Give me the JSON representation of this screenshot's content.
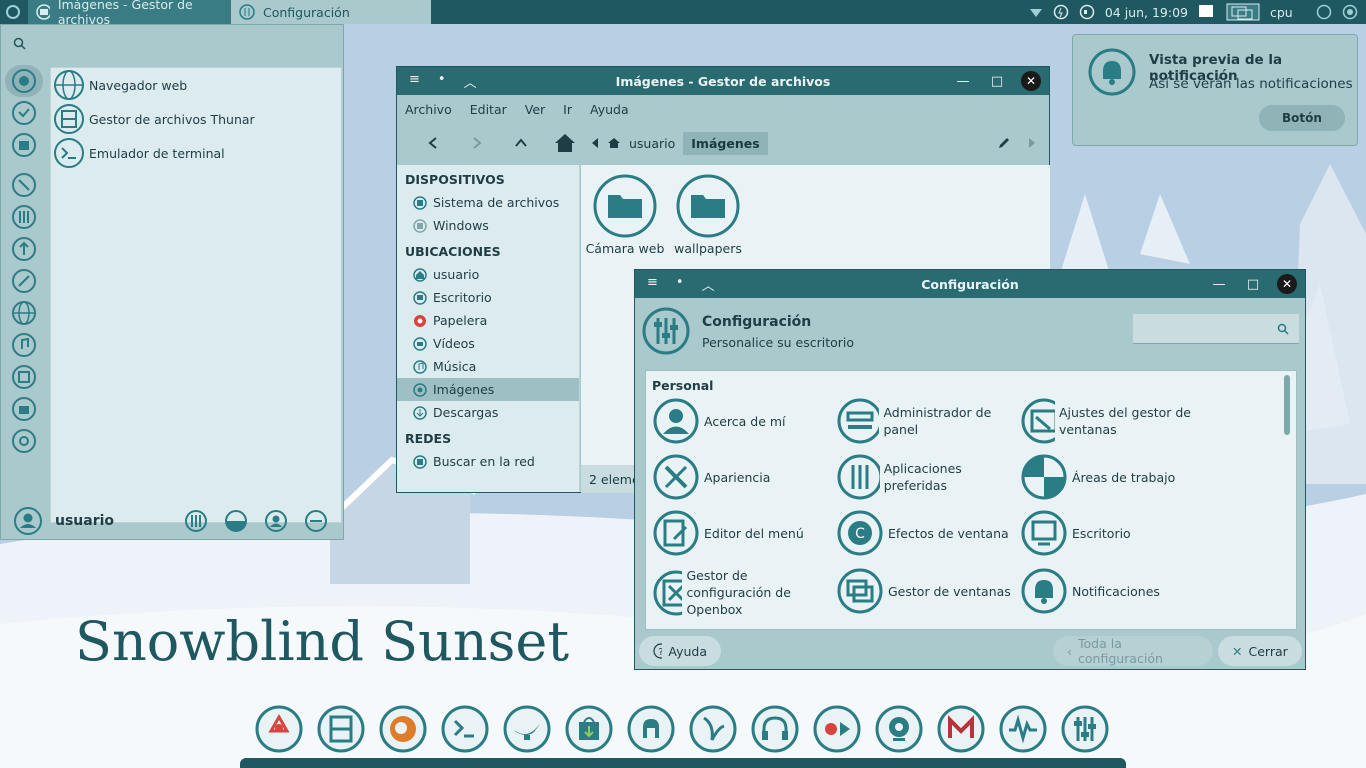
{
  "top_panel": {
    "tasks": [
      {
        "label": "Imágenes - Gestor de archivos",
        "icon": "folder-icon"
      },
      {
        "label": "Configuración",
        "icon": "settings-icon"
      }
    ],
    "datetime": "04 jun, 19:09",
    "cpu_label": "cpu"
  },
  "whisker": {
    "search_placeholder": "",
    "apps": [
      {
        "label": "Navegador web",
        "icon": "globe-icon"
      },
      {
        "label": "Gestor de archivos Thunar",
        "icon": "file-cabinet-icon"
      },
      {
        "label": "Emulador de terminal",
        "icon": "terminal-icon"
      }
    ],
    "user": "usuario"
  },
  "notification": {
    "title": "Vista previa de la notificación",
    "body": "Así se verán las notificaciones",
    "button": "Botón"
  },
  "thunar": {
    "title": "Imágenes - Gestor de archivos",
    "menu": [
      "Archivo",
      "Editar",
      "Ver",
      "Ir",
      "Ayuda"
    ],
    "breadcrumb": {
      "parent": "usuario",
      "current": "Imágenes"
    },
    "sections": {
      "devices": "DISPOSITIVOS",
      "places": "UBICACIONES",
      "network": "REDES"
    },
    "devices": [
      "Sistema de archivos",
      "Windows"
    ],
    "places": [
      "usuario",
      "Escritorio",
      "Papelera",
      "Vídeos",
      "Música",
      "Imágenes",
      "Descargas"
    ],
    "network": [
      "Buscar en la red"
    ],
    "folders": [
      "Cámara web",
      "wallpapers"
    ],
    "status": "2 eleme"
  },
  "settings": {
    "title": "Configuración",
    "header_title": "Configuración",
    "header_subtitle": "Personalice su escritorio",
    "section": "Personal",
    "items": [
      "Acerca de mí",
      "Administrador de panel",
      "Ajustes del gestor de ventanas",
      "Apariencia",
      "Aplicaciones preferidas",
      "Áreas de trabajo",
      "Editor del menú",
      "Efectos de ventana",
      "Escritorio",
      "Gestor de configuración de Openbox",
      "Gestor de ventanas",
      "Notificaciones"
    ],
    "help_button": "Ayuda",
    "all_button": "Toda la configuración",
    "close_button": "Cerrar"
  },
  "desktop_title": "Snowblind Sunset",
  "dock": [
    "recycle-icon",
    "file-cabinet-icon",
    "firefox-icon",
    "terminal-icon",
    "genie-lamp-icon",
    "store-bag-icon",
    "ubuntu-app-icon",
    "boomerang-icon",
    "headphones-icon",
    "record-play-icon",
    "webcam-icon",
    "gmail-icon",
    "activity-monitor-icon",
    "sliders-icon"
  ],
  "colors": {
    "panel": "#1f5860",
    "accent": "#2a7c85",
    "window": "#a9c9cc",
    "content": "#dcebee"
  }
}
